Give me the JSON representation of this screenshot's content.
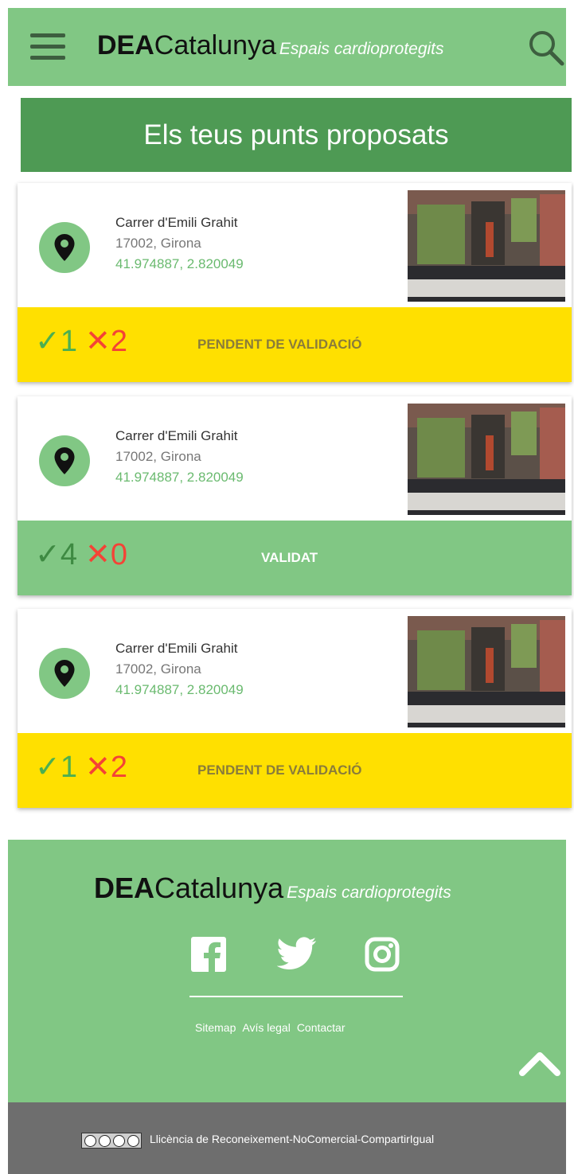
{
  "header": {
    "brand_bold": "DEA",
    "brand_light": "Catalunya",
    "tagline": "Espais cardioprotegits",
    "menu_icon": "hamburger-icon",
    "search_icon": "search-icon"
  },
  "page": {
    "title": "Els teus punts proposats"
  },
  "proposals": [
    {
      "street": "Carrer d'Emili Grahit",
      "city": "17002, Girona",
      "coords": "41.974887, 2.820049",
      "votes_ok": "✓1",
      "votes_ko": "✕2",
      "status": "PENDENT DE VALIDACIÓ"
    },
    {
      "street": "Carrer d'Emili Grahit",
      "city": "17002, Girona",
      "coords": "41.974887, 2.820049",
      "votes_ok": "✓4",
      "votes_ko": "✕0",
      "status": "VALIDAT"
    },
    {
      "street": "Carrer d'Emili Grahit",
      "city": "17002, Girona",
      "coords": "41.974887, 2.820049",
      "votes_ok": "✓1",
      "votes_ko": "✕2",
      "status": "PENDENT DE VALIDACIÓ"
    }
  ],
  "footer": {
    "brand_bold": "DEA",
    "brand_light": "Catalunya",
    "tagline": "Espais cardioprotegits",
    "social_icons": [
      "facebook-icon",
      "twitter-icon",
      "instagram-icon"
    ],
    "links": [
      "Sitemap",
      "Avís legal",
      "Contactar"
    ],
    "license": "Llicència de Reconeixement-NoComercial-CompartirIgual"
  },
  "colors": {
    "primary_green": "#81c784",
    "banner_green": "#4e9a54",
    "pending_yellow": "#ffe000",
    "coords_green": "#6aba6f",
    "vote_red": "#f44336",
    "bottom_gray": "#6e6e6e"
  }
}
